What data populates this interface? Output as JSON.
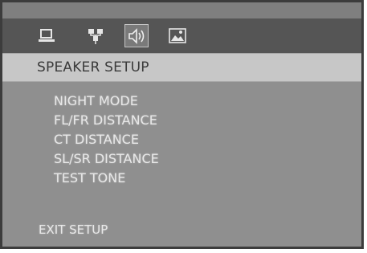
{
  "tabs": [
    {
      "icon": "monitor-icon",
      "active": false
    },
    {
      "icon": "network-icon",
      "active": false
    },
    {
      "icon": "speaker-icon",
      "active": true
    },
    {
      "icon": "picture-icon",
      "active": false
    }
  ],
  "header": {
    "title": "SPEAKER SETUP"
  },
  "menu": {
    "items": [
      {
        "label": "NIGHT MODE"
      },
      {
        "label": "FL/FR DISTANCE"
      },
      {
        "label": "CT DISTANCE"
      },
      {
        "label": "SL/SR DISTANCE"
      },
      {
        "label": "TEST TONE"
      }
    ]
  },
  "footer": {
    "exit_label": "EXIT SETUP"
  },
  "colors": {
    "panel": "#8f8f8f",
    "icon_bar": "#555555",
    "header_bar": "#c7c7c7",
    "text": "#e8e8e8"
  }
}
